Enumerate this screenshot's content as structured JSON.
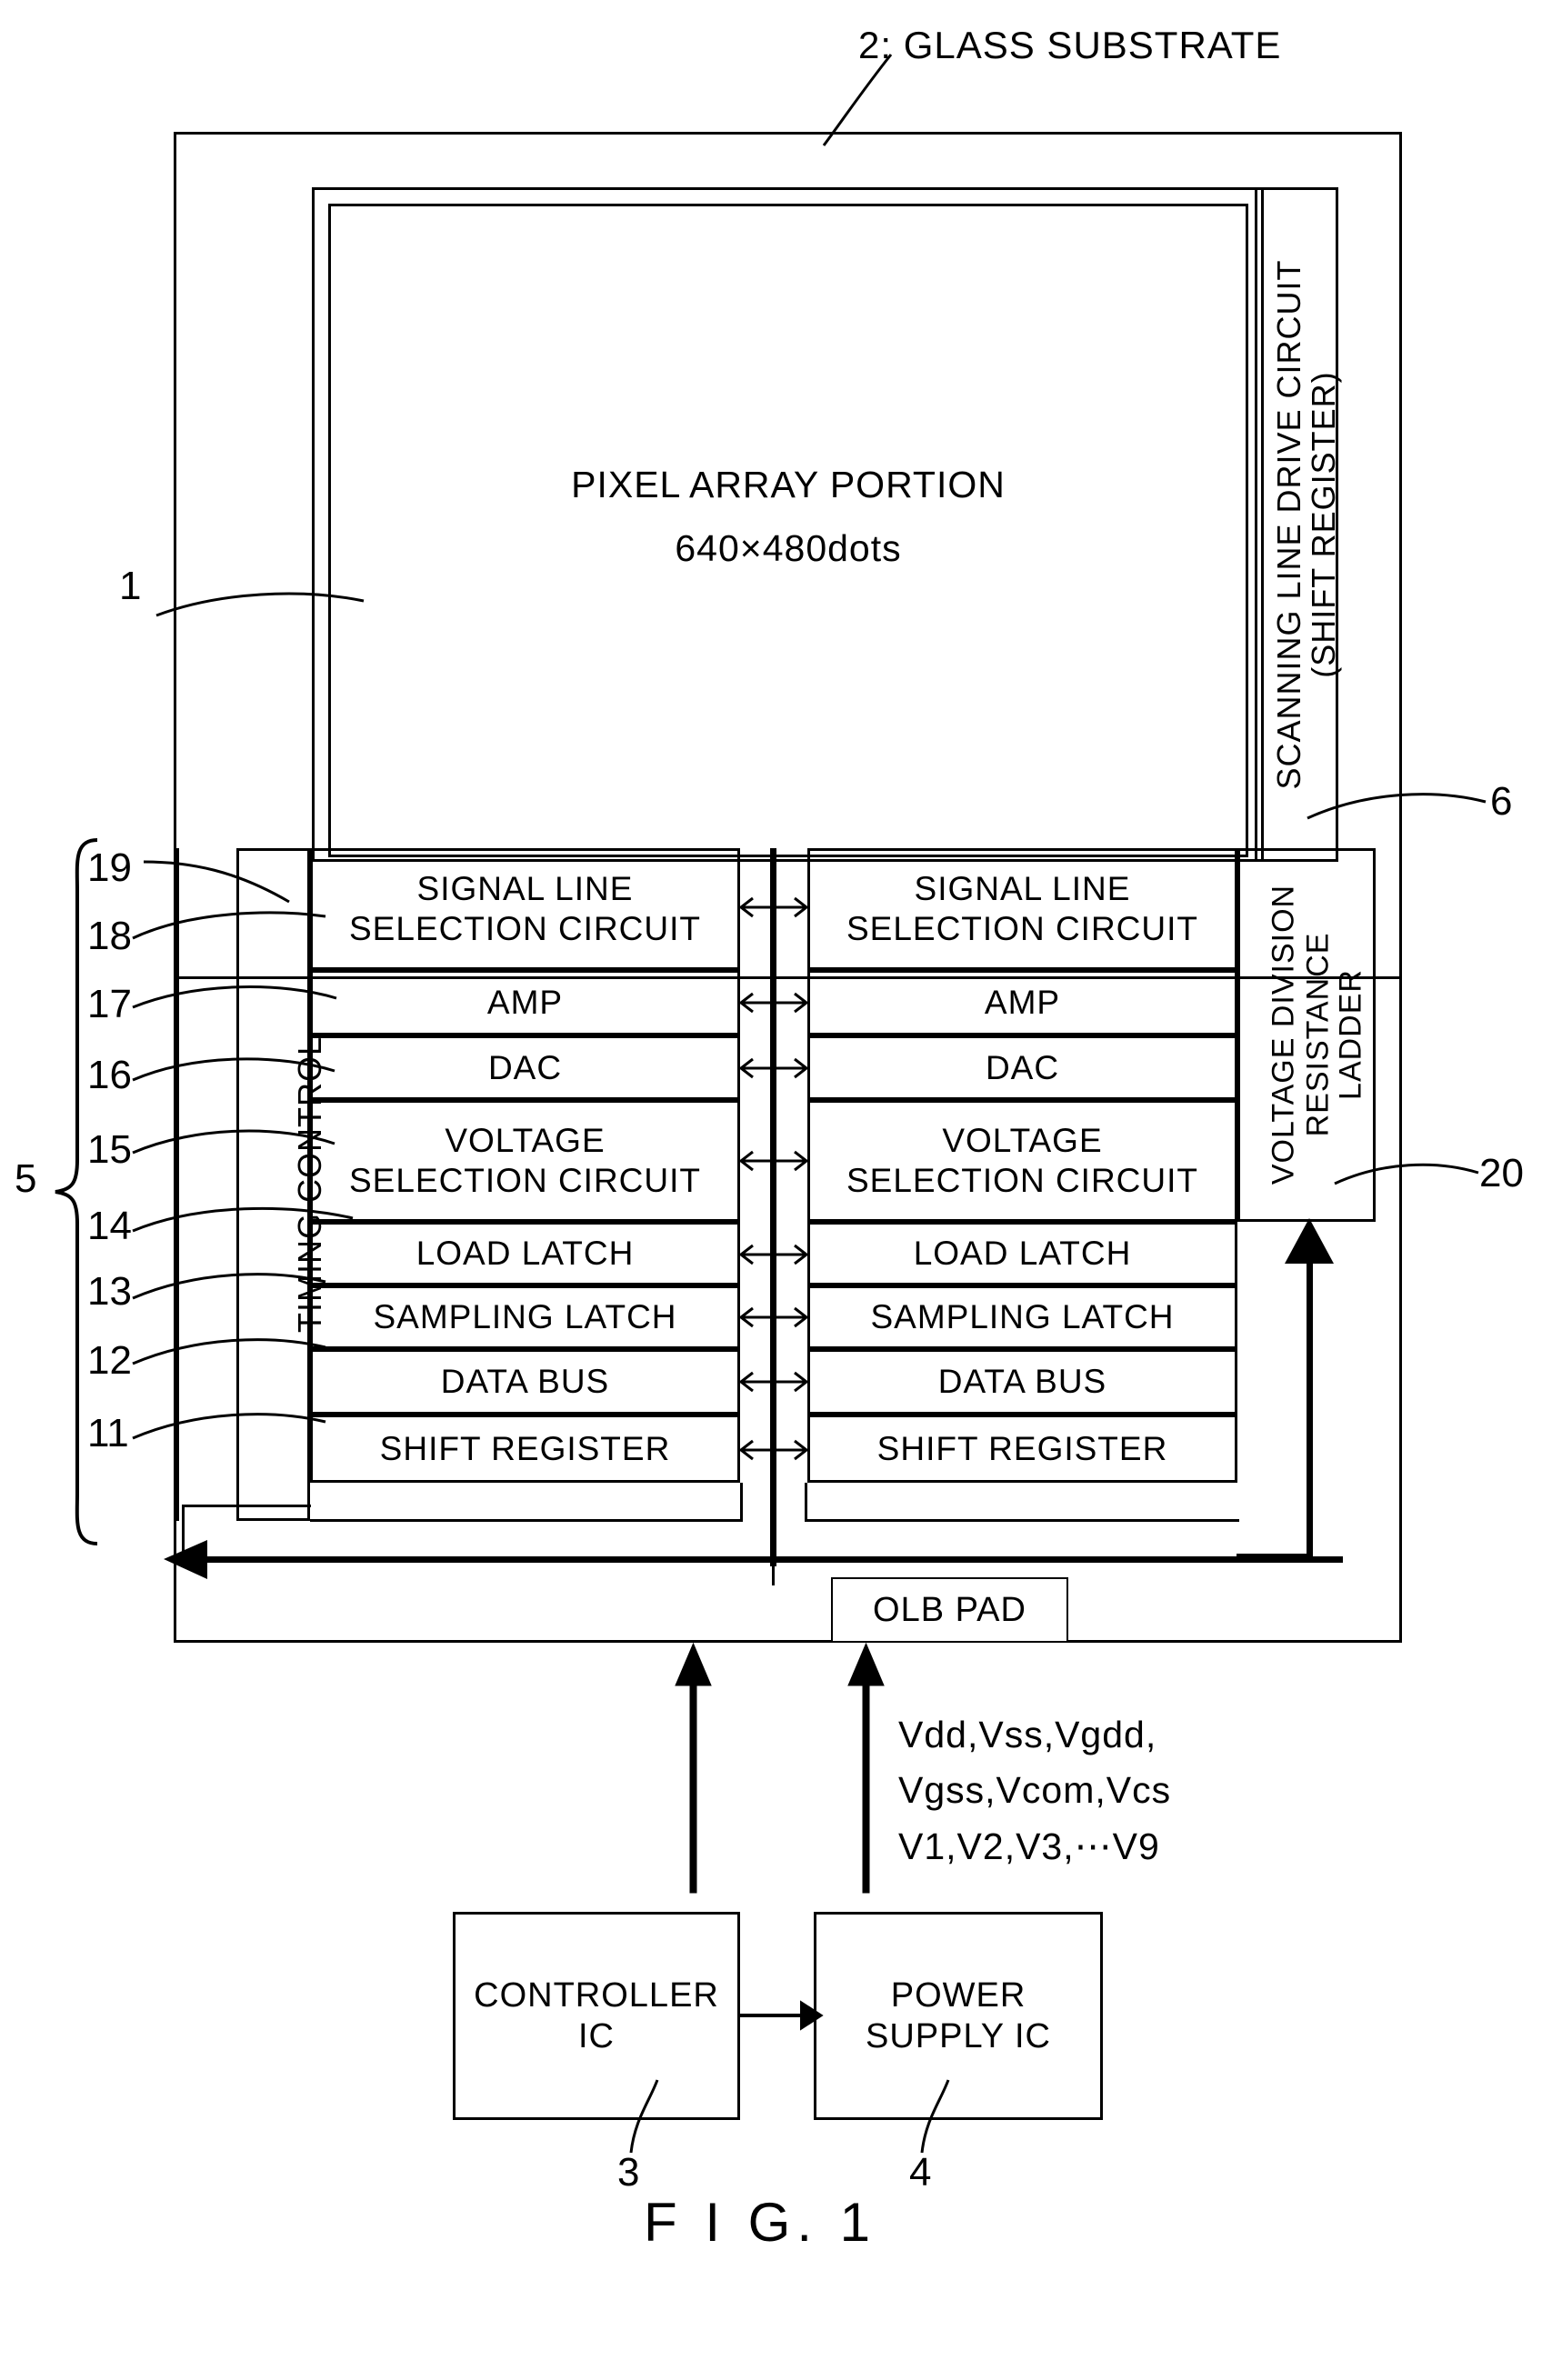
{
  "figure": {
    "caption": "F I G.  1",
    "top_label": "2:  GLASS SUBSTRATE"
  },
  "pixel_array": {
    "title": "PIXEL ARRAY PORTION",
    "spec": "640×480dots",
    "ref": "1"
  },
  "scanning_driver": {
    "line1": "SCANNING LINE DRIVE CIRCUIT",
    "line2": "(SHIFT REGISTER)",
    "ref": "6"
  },
  "ladder": {
    "line1": "VOLTAGE DIVISION",
    "line2": "RESISTANCE",
    "line3": "LADDER",
    "ref": "20"
  },
  "timing_control": {
    "label": "TIMING CONTROL"
  },
  "driver_group": {
    "brace_ref": "5",
    "refs": [
      "19",
      "18",
      "17",
      "16",
      "15",
      "14",
      "13",
      "12",
      "11"
    ],
    "rows": [
      {
        "ref": "19",
        "label": "SIGNAL LINE\nSELECTION CIRCUIT",
        "lines": [
          "SIGNAL LINE",
          "SELECTION CIRCUIT"
        ]
      },
      {
        "ref": "17",
        "label": "AMP",
        "lines": [
          "AMP"
        ]
      },
      {
        "ref": "16",
        "label": "DAC",
        "lines": [
          "DAC"
        ]
      },
      {
        "ref": "15",
        "label": "VOLTAGE\nSELECTION CIRCUIT",
        "lines": [
          "VOLTAGE",
          "SELECTION CIRCUIT"
        ]
      },
      {
        "ref": "14",
        "label": "LOAD LATCH",
        "lines": [
          "LOAD LATCH"
        ]
      },
      {
        "ref": "13",
        "label": "SAMPLING LATCH",
        "lines": [
          "SAMPLING LATCH"
        ]
      },
      {
        "ref": "12",
        "label": "DATA BUS",
        "lines": [
          "DATA BUS"
        ]
      },
      {
        "ref": "11",
        "label": "SHIFT REGISTER",
        "lines": [
          "SHIFT REGISTER"
        ]
      }
    ]
  },
  "olb_pad": {
    "label": "OLB PAD"
  },
  "power_signals": {
    "line1": "Vdd,Vss,Vgdd,",
    "line2": "Vgss,Vcom,Vcs",
    "line3": "V1,V2,V3,⋯V9"
  },
  "controller_ic": {
    "line1": "CONTROLLER",
    "line2": "IC",
    "ref": "3"
  },
  "power_supply_ic": {
    "line1": "POWER",
    "line2": "SUPPLY IC",
    "ref": "4"
  },
  "colors": {
    "ink": "#000000",
    "paper": "#ffffff"
  }
}
